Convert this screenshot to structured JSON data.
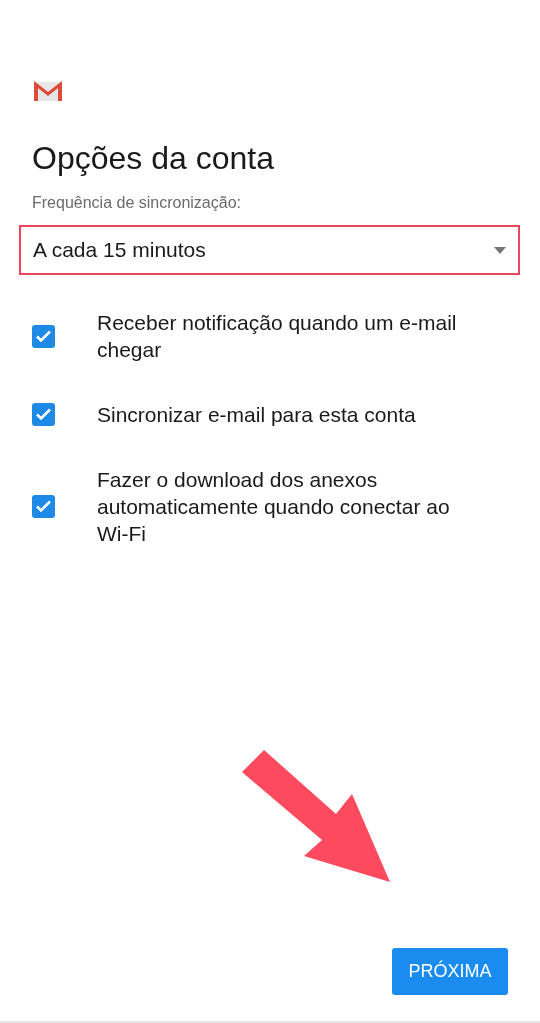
{
  "title": "Opções da conta",
  "sync_frequency": {
    "label": "Frequência de sincronização:",
    "value": "A cada 15 minutos",
    "highlighted": true
  },
  "options": [
    {
      "label": "Receber notificação quando um e-mail chegar",
      "checked": true
    },
    {
      "label": "Sincronizar e-mail para esta conta",
      "checked": true
    },
    {
      "label": "Fazer o download dos anexos automaticamente quando conectar ao Wi-Fi",
      "checked": true
    }
  ],
  "annotations": [
    {
      "kind": "arrow"
    }
  ],
  "next_button": "PRÓXIMA"
}
